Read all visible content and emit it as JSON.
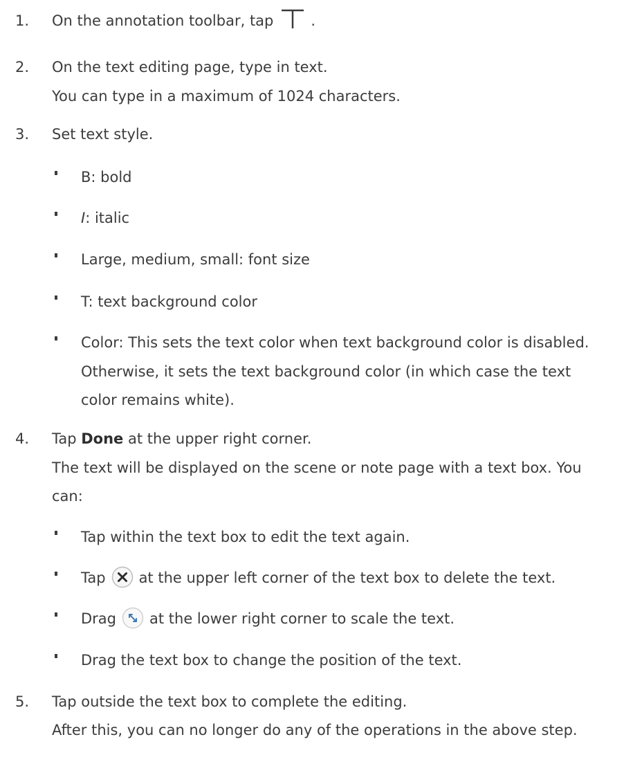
{
  "steps": [
    {
      "num": "1.",
      "before_icon": "On the annotation toolbar, tap",
      "icon": "text-tool-icon",
      "after_icon": "."
    },
    {
      "num": "2.",
      "text": "On the text editing page, type in text.",
      "detail": "You can type in a maximum of 1024 characters."
    },
    {
      "num": "3.",
      "text": "Set text style.",
      "bullets": [
        {
          "key": "B",
          "rest": ": bold"
        },
        {
          "key": "I",
          "rest": ": italic"
        },
        {
          "text": "Large, medium, small: font size"
        },
        {
          "text": "T: text background color"
        },
        {
          "lines": [
            "Color: This sets the text color when text background color is disabled.",
            "Otherwise, it sets the text background color (in which case the text",
            "color remains white)."
          ]
        }
      ]
    },
    {
      "num": "4.",
      "before_bold": "Tap ",
      "bold": "Done",
      "after_bold": " at the upper right corner.",
      "detail_lines": [
        "The text will be displayed on the scene or note page with a text box. You",
        "can:"
      ],
      "bullets": [
        {
          "text": "Tap within the text box to edit the text again."
        },
        {
          "before_icon": "Tap",
          "icon": "close-circle-icon",
          "after_icon": "at the upper left corner of the text box to delete the text."
        },
        {
          "before_icon": "Drag",
          "icon": "scale-handle-icon",
          "after_icon": "at the lower right corner to scale the text."
        },
        {
          "text": "Drag the text box to change the position of the text."
        }
      ]
    },
    {
      "num": "5.",
      "text": "Tap outside the text box to complete the editing.",
      "detail": "After this, you can no longer do any of the operations in the above step."
    }
  ]
}
